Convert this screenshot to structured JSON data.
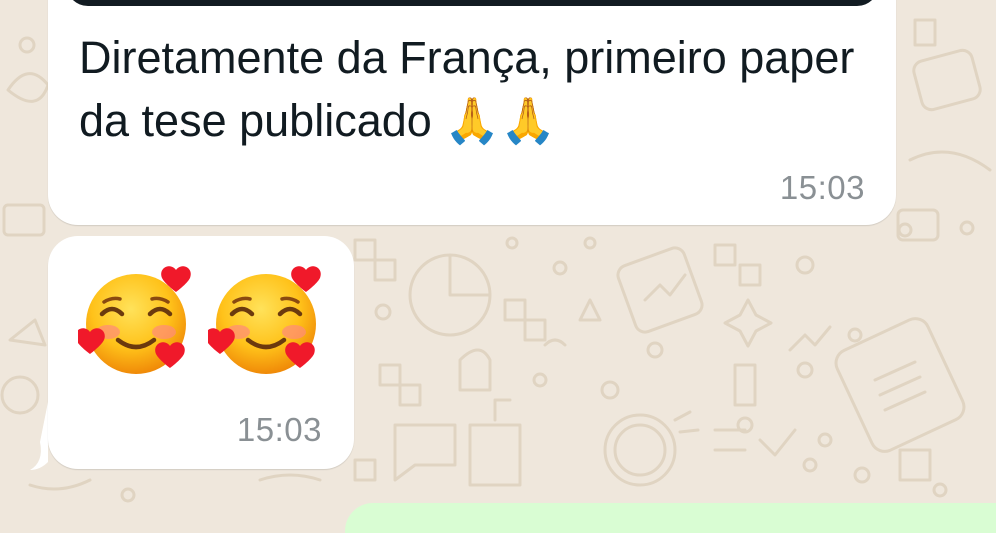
{
  "messages": [
    {
      "text": "Diretamente da França, primeiro paper da tese publicado 🙏🙏",
      "time": "15:03"
    },
    {
      "emojis": [
        "smiling-face-with-hearts",
        "smiling-face-with-hearts"
      ],
      "time": "15:03"
    }
  ],
  "colors": {
    "wallpaper": "#efe7dc",
    "bubble_incoming": "#ffffff",
    "bubble_outgoing": "#d9fdd3",
    "text": "#111b21",
    "timestamp": "#8a9094"
  }
}
